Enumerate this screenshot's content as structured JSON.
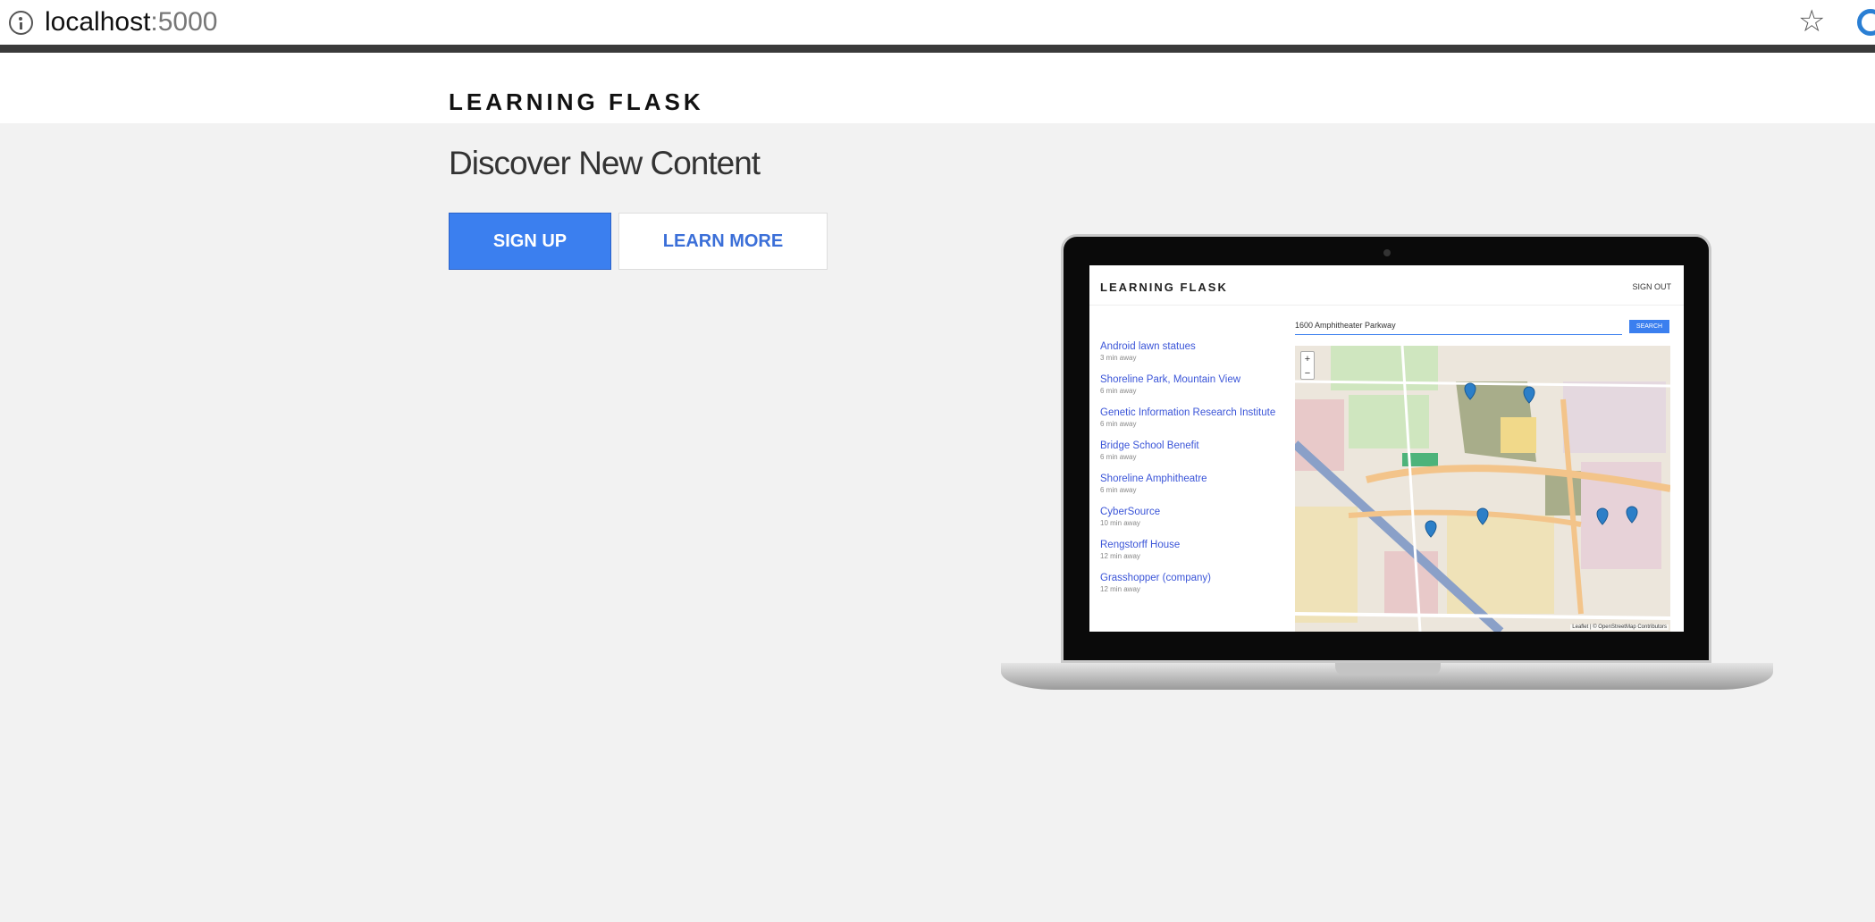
{
  "browser": {
    "url_host": "localhost",
    "url_port": ":5000"
  },
  "site": {
    "brand": "LEARNING FLASK",
    "hero_title": "Discover New Content",
    "signup_label": "SIGN UP",
    "learn_more_label": "LEARN MORE"
  },
  "preview": {
    "brand": "LEARNING FLASK",
    "signout_label": "SIGN OUT",
    "search_value": "1600 Amphitheater Parkway",
    "search_button": "SEARCH",
    "places": [
      {
        "title": "Android lawn statues",
        "meta": "3 min away"
      },
      {
        "title": "Shoreline Park, Mountain View",
        "meta": "6 min away"
      },
      {
        "title": "Genetic Information Research Institute",
        "meta": "6 min away"
      },
      {
        "title": "Bridge School Benefit",
        "meta": "6 min away"
      },
      {
        "title": "Shoreline Amphitheatre",
        "meta": "6 min away"
      },
      {
        "title": "CyberSource",
        "meta": "10 min away"
      },
      {
        "title": "Rengstorff House",
        "meta": "12 min away"
      },
      {
        "title": "Grasshopper (company)",
        "meta": "12 min away"
      }
    ],
    "map": {
      "zoom_in": "+",
      "zoom_out": "−",
      "attribution": "Leaflet | © OpenStreetMap Contributors"
    }
  },
  "colors": {
    "accent": "#3b7fef",
    "link": "#3b55d8",
    "page_bg": "#f2f2f2"
  }
}
